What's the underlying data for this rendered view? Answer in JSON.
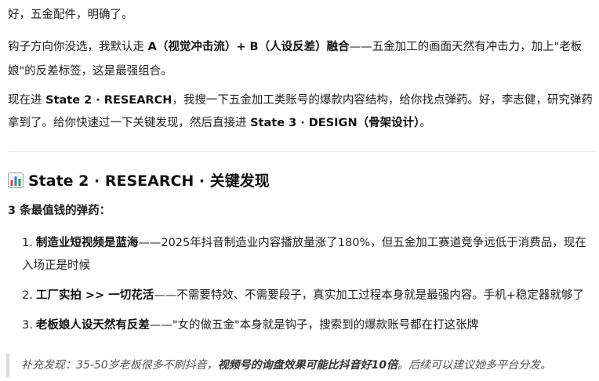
{
  "intro": {
    "line1": "好，五金配件，明确了。"
  },
  "para2": {
    "pre": "钩子方向你没选，我默认走 ",
    "bold": "A（视觉冲击流）+ B（人设反差）融合",
    "post": "——五金加工的画面天然有冲击力，加上\"老板娘\"的反差标签，这是最强组合。"
  },
  "para3": {
    "pre": "现在进 ",
    "bold1": "State 2 · RESEARCH",
    "mid": "，我搜一下五金加工类账号的爆款内容结构，给你找点弹药。好，李志健，研究弹药拿到了。给你快速过一下关键发现，然后直接进 ",
    "bold2": "State 3 · DESIGN（骨架设计）",
    "post": "。"
  },
  "section": {
    "icon": "bar-chart-icon",
    "title": "State 2 · RESEARCH · 关键发现",
    "subtitle": "3 条最值钱的弹药："
  },
  "findings": [
    {
      "num": "1.",
      "bold": "制造业短视频是蓝海",
      "text": "——2025年抖音制造业内容播放量涨了180%，但五金加工赛道竞争远低于消费品，现在入场正是时候"
    },
    {
      "num": "2.",
      "bold": "工厂实拍 >> 一切花活",
      "text": "——不需要特效、不需要段子，真实加工过程本身就是最强内容。手机+稳定器就够了"
    },
    {
      "num": "3.",
      "bold": "老板娘人设天然有反差",
      "text": "——\"女的做五金\"本身就是钩子，搜索到的爆款账号都在打这张牌"
    }
  ],
  "note": {
    "pre": "补充发现：35-50岁老板很多不刷抖音，",
    "bold": "视频号的询盘效果可能比抖音好10倍",
    "post": "。后续可以建议她多平台分发。"
  },
  "colors": {
    "text": "#1f1f1f",
    "divider": "#e6e6e6",
    "quote_border": "#d9d9d9",
    "quote_text": "#555555"
  }
}
